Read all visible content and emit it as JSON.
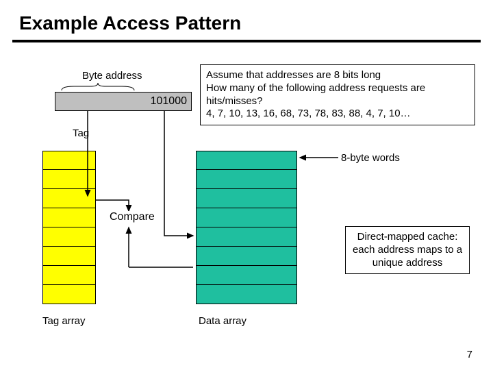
{
  "title": "Example Access Pattern",
  "byte_address_label": "Byte address",
  "address_bits": "101000",
  "tag_label": "Tag",
  "assume_text": "Assume that addresses are 8 bits long\nHow many of the following address requests are hits/misses?\n4, 7, 10, 13, 16, 68, 73, 78, 83, 88, 4, 7, 10…",
  "words_label": "8-byte words",
  "direct_mapped_text": "Direct-mapped cache: each address maps to a unique address",
  "compare_label": "Compare",
  "tag_array_label": "Tag array",
  "data_array_label": "Data array",
  "page_number": "7",
  "tag_array_rows": 8,
  "data_array_rows": 8,
  "chart_data": {
    "type": "table",
    "title": "Example Access Pattern — direct-mapped cache",
    "address_bits": 8,
    "word_size_bytes": 8,
    "sample_address_binary": "101000",
    "access_sequence": [
      4,
      7,
      10,
      13,
      16,
      68,
      73,
      78,
      83,
      88,
      4,
      7,
      10
    ],
    "tag_array_entries": 8,
    "data_array_entries": 8,
    "question": "How many of the following address requests are hits/misses?"
  }
}
